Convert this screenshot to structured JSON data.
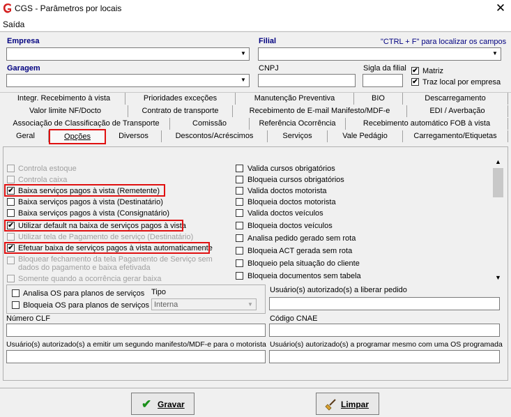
{
  "window": {
    "title": "CGS - Parâmetros por locais",
    "close": "✕"
  },
  "menu": {
    "saida": "Saída"
  },
  "form": {
    "empresa_label": "Empresa",
    "filial_label": "Filial",
    "ctrl_hint": "\"CTRL + F\" para localizar os campos",
    "garagem_label": "Garagem",
    "cnpj_label": "CNPJ",
    "sigla_label": "Sigla da filial",
    "matriz_label": "Matriz",
    "matriz_checked": true,
    "traz_local_label": "Traz local por empresa",
    "traz_local_checked": true
  },
  "tabs": {
    "row1": [
      "Integr. Recebimento à vista",
      "Prioridades exceções",
      "Manutenção Preventiva",
      "BIO",
      "Descarregamento"
    ],
    "row2": [
      "Valor limite NF/Docto",
      "Contrato de transporte",
      "Recebimento de E-mail Manifesto/MDF-e",
      "EDI / Averbação"
    ],
    "row3": [
      "Associação de Classificação de Transporte",
      "Comissão",
      "Referência Ocorrência",
      "Recebimento automático FOB à vista"
    ],
    "row4": [
      "Geral",
      "Opções",
      "Diversos",
      "Descontos/Acréscimos",
      "Serviços",
      "Vale Pedágio",
      "Carregamento/Etiquetas"
    ],
    "active": "Opções"
  },
  "options_left": [
    {
      "label": "Controla estoque",
      "checked": false,
      "disabled": true
    },
    {
      "label": "Controla caixa",
      "checked": false,
      "disabled": true
    },
    {
      "label": "Baixa serviços pagos à vista (Remetente)",
      "checked": true,
      "disabled": false
    },
    {
      "label": "Baixa serviços pagos à vista (Destinatário)",
      "checked": false,
      "disabled": false
    },
    {
      "label": "Baixa serviços pagos à vista (Consignatário)",
      "checked": false,
      "disabled": false
    },
    {
      "label": "Utilizar default na baixa de serviços pagos à vista",
      "checked": true,
      "disabled": false
    },
    {
      "label": "Utilizar tela de Pagamento de serviço (Destinatário)",
      "checked": false,
      "disabled": true
    },
    {
      "label": "Efetuar baixa de serviços pagos à vista automaticamente",
      "checked": true,
      "disabled": false
    },
    {
      "label": "Bloquear fechamento da tela Pagamento de Serviço sem",
      "label2": "dados do pagamento e baixa efetivada",
      "checked": false,
      "disabled": true
    },
    {
      "label": "Somente quando a ocorrência gerar baixa",
      "checked": false,
      "disabled": true
    }
  ],
  "options_right": [
    {
      "label": "Valida cursos obrigatórios"
    },
    {
      "label": "Bloqueia cursos obrigatórios"
    },
    {
      "label": "Valida doctos motorista"
    },
    {
      "label": "Bloqueia doctos motorista"
    },
    {
      "label": "Valida doctos veículos"
    },
    {
      "label": "Bloqueia doctos veículos"
    },
    {
      "label": "Analisa pedido gerado sem rota"
    },
    {
      "label": "Bloqueia ACT gerada sem rota"
    },
    {
      "label": "Bloqueio pela situação do cliente"
    },
    {
      "label": "Bloqueia documentos sem tabela"
    }
  ],
  "os_group": {
    "analisa_label": "Analisa OS para planos de serviços",
    "bloqueia_label": "Bloqueia OS para planos de serviços",
    "tipo_label": "Tipo",
    "tipo_value": "Interna"
  },
  "fields": {
    "usuarios_liberar_label": "Usuário(s) autorizado(s) a liberar pedido",
    "numero_clf_label": "Número CLF",
    "codigo_cnae_label": "Código CNAE",
    "usuarios_manifesto_label": "Usuário(s) autorizado(s) a emitir um segundo manifesto/MDF-e para o motorista",
    "usuarios_programar_label": "Usuário(s) autorizado(s) a programar mesmo com uma OS programada"
  },
  "buttons": {
    "gravar": "Gravar",
    "limpar": "Limpar"
  },
  "colors": {
    "accent_red": "#e01010",
    "label_blue": "#000080",
    "check_green": "#1a8f1a"
  }
}
